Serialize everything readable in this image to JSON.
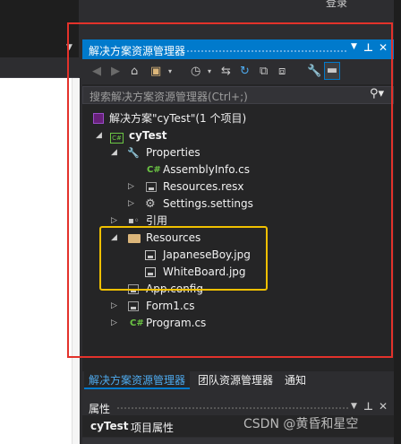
{
  "top_right_text": "登录",
  "panel": {
    "title": "解决方案资源管理器",
    "controls": [
      "▾",
      "⊣",
      "✕"
    ],
    "search_placeholder": "搜索解决方案资源管理器(Ctrl+;)"
  },
  "toolbar_icons": [
    "back-icon",
    "forward-icon",
    "home-icon",
    "switch-views-icon",
    "dropdown-icon",
    "pending-changes-icon",
    "dropdown-icon",
    "sync-icon",
    "refresh-icon",
    "collapse-all-icon",
    "show-all-files-icon",
    "properties-wrench-icon",
    "preview-icon"
  ],
  "tree": {
    "solution": "解决方案\"cyTest\"(1 个项目)",
    "project": "cyTest",
    "properties": "Properties",
    "assembly_info": "AssemblyInfo.cs",
    "resources_resx": "Resources.resx",
    "settings": "Settings.settings",
    "references": "引用",
    "resources_folder": "Resources",
    "japanese_boy": "JapaneseBoy.jpg",
    "white_board": "WhiteBoard.jpg",
    "app_config": "App.config",
    "form1": "Form1.cs",
    "program": "Program.cs"
  },
  "bottom_tabs": [
    "解决方案资源管理器",
    "团队资源管理器",
    "通知"
  ],
  "properties_panel": {
    "title": "属性",
    "object_name": "cyTest",
    "object_type": "项目属性"
  },
  "watermark": "CSDN @黄昏和星空",
  "colors": {
    "accent": "#007acc",
    "highlight_box": "#f0c000",
    "outline_box": "#e3322b",
    "cs_icon": "#6cc644"
  }
}
